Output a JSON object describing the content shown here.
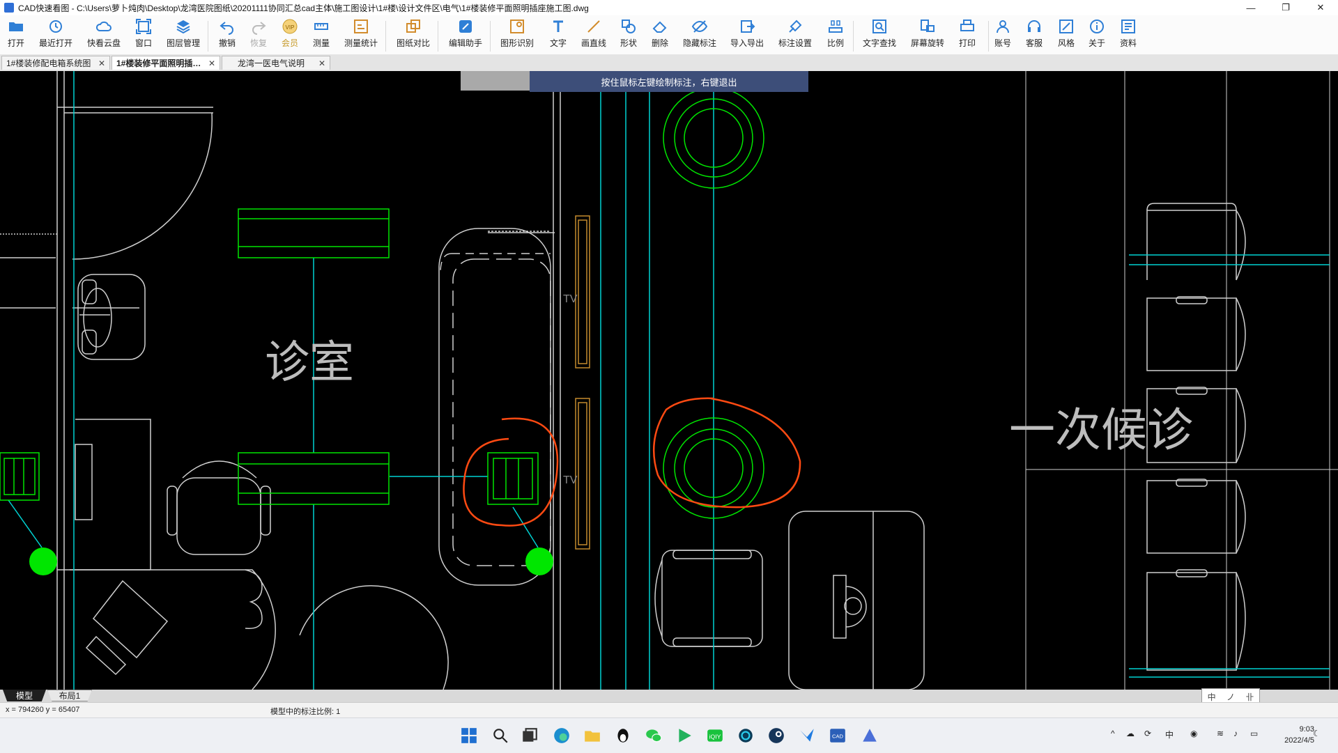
{
  "window": {
    "title": "CAD快速看图 - C:\\Users\\萝卜炖肉\\Desktop\\龙湾医院图纸\\20201111协同汇总cad主体\\施工图设计\\1#楼\\设计文件区\\电气\\1#楼装修平面照明插座施工图.dwg",
    "minimize": "—",
    "restore": "❐",
    "close": "✕"
  },
  "toolbar": {
    "open": "打开",
    "recent": "最近打开",
    "cloud": "快看云盘",
    "window": "窗口",
    "layers": "图层管理",
    "undo": "撤销",
    "redo": "恢复",
    "vip": "会员",
    "measure": "测量",
    "measure_stats": "测量统计",
    "compare": "图纸对比",
    "edit_assistant": "编辑助手",
    "shape_recognition": "图形识别",
    "text": "文字",
    "line": "画直线",
    "shape": "形状",
    "delete": "删除",
    "hide_annotation": "隐藏标注",
    "import_export": "导入导出",
    "annotation_settings": "标注设置",
    "scale": "比例",
    "text_search": "文字查找",
    "screen_rotate": "屏幕旋转",
    "print": "打印",
    "account": "账号",
    "support": "客服",
    "style": "风格",
    "about": "关于",
    "resources": "资料",
    "vip_badge": "VIP"
  },
  "tabs": [
    {
      "label": "1#楼装修配电箱系统图",
      "close": "✕"
    },
    {
      "label": "1#楼装修平面照明插…",
      "close": "✕"
    },
    {
      "label": "龙湾一医电气说明",
      "close": "✕"
    }
  ],
  "canvas": {
    "hint": "按住鼠标左键绘制标注，右键退出",
    "room1": "诊室",
    "room2": "一次候诊",
    "tv": "TV"
  },
  "layout_tabs": {
    "model": "模型",
    "layout1": "布局1"
  },
  "ime": [
    "中",
    "ノ",
    "卝"
  ],
  "status": {
    "coords": "x = 794260  y = 65407",
    "scale_text": "模型中的标注比例: 1"
  },
  "taskbar": {
    "time": "9:03",
    "date": "2022/4/5",
    "ime": "中",
    "iqiyi": "iQIY",
    "cad": "CAD"
  },
  "colors": {
    "accent": "#2f7fd6",
    "cad_cyan": "#00d2d2",
    "cad_green": "#00ff00",
    "cad_bg": "#000000",
    "markup": "#ff4a12",
    "hint_bg": "#3d4e79"
  }
}
